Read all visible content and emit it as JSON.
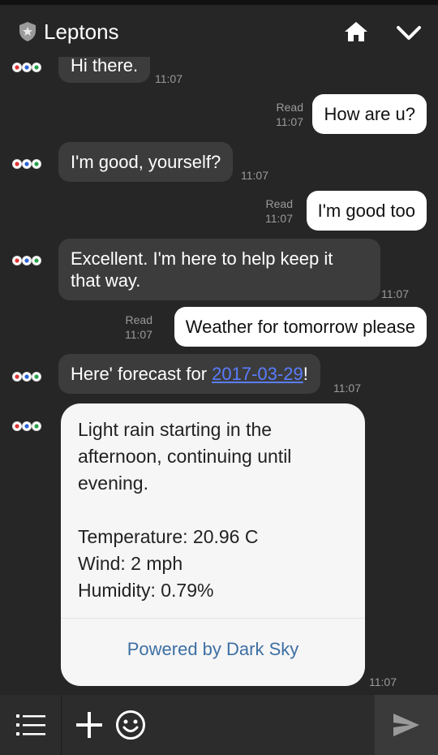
{
  "header": {
    "title": "Leptons",
    "shield_icon": "shield-star-icon",
    "home_icon": "home-icon",
    "collapse_icon": "chevron-down-icon"
  },
  "messages": [
    {
      "from": "bot",
      "text": "Hi there.",
      "time": "11:07"
    },
    {
      "from": "user",
      "text": "How are u?",
      "status": "Read",
      "time": "11:07"
    },
    {
      "from": "bot",
      "text": "I'm good, yourself?",
      "time": "11:07"
    },
    {
      "from": "user",
      "text": "I'm good too",
      "status": "Read",
      "time": "11:07"
    },
    {
      "from": "bot",
      "line1": "Excellent. I'm here to help keep it",
      "line2": "that way.",
      "time": "11:07"
    },
    {
      "from": "user",
      "text": "Weather for tomorrow please",
      "status": "Read",
      "time": "11:07"
    },
    {
      "from": "bot",
      "prefix": "Here' forecast for ",
      "link": "2017-03-29",
      "suffix": "!",
      "time": "11:07"
    }
  ],
  "forecast_card": {
    "line1": "Light rain starting in the",
    "line2": "afternoon, continuing until",
    "line3": "evening.",
    "temperature": "Temperature: 20.96 C",
    "wind": "Wind: 2 mph",
    "humidity": "Humidity: 0.79%",
    "powered_by": "Powered by Dark Sky",
    "time": "11:07"
  },
  "composer": {
    "menu_icon": "list-icon",
    "add_icon": "plus-icon",
    "emoji_icon": "smiley-icon",
    "send_icon": "send-icon"
  },
  "colors": {
    "background": "#262626",
    "bot_bubble": "#3c3c3c",
    "user_bubble": "#ffffff",
    "link": "#5a7dff",
    "powered_link": "#3d6fa3"
  }
}
